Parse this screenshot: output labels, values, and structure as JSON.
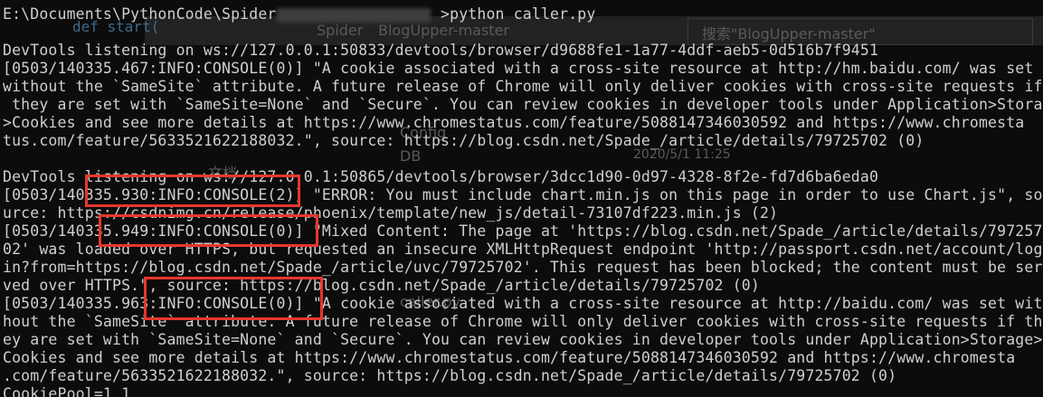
{
  "background_window": {
    "path_segments": [
      "Spider",
      "BlogUpper-master"
    ],
    "search_placeholder": "搜索\"BlogUpper-master\"",
    "sidebar_label": "文档",
    "entry_date": "2020/5/1 11:25",
    "file_entries": [
      "DB",
      "Config",
      "caller.py"
    ],
    "editor_text": "def start("
  },
  "console": {
    "lines": [
      "E:\\Documents\\PythonCode\\Spider                  >python caller.py",
      "",
      "DevTools listening on ws://127.0.0.1:50833/devtools/browser/d9688fe1-1a77-4ddf-aeb5-0d516b7f9451",
      "[0503/140335.467:INFO:CONSOLE(0)] \"A cookie associated with a cross-site resource at http://hm.baidu.com/ was set",
      "without the `SameSite` attribute. A future release of Chrome will only deliver cookies with cross-site requests if",
      " they are set with `SameSite=None` and `Secure`. You can review cookies in developer tools under Application>Storage",
      ">Cookies and see more details at https://www.chromestatus.com/feature/5088147346030592 and https://www.chromesta",
      "tus.com/feature/5633521622188032.\", source: https://blog.csdn.net/Spade_/article/details/79725702 (0)",
      "",
      "DevTools listening on ws://127.0.0.1:50865/devtools/browser/3dcc1d90-0d97-4328-8f2e-fd7d6ba6eda0",
      "[0503/140335.930:INFO:CONSOLE(2)] \"ERROR: You must include chart.min.js on this page in order to use Chart.js\", so",
      "urce: https://csdnimg.cn/release/phoenix/template/new_js/detail-73107df223.min.js (2)",
      "[0503/140335.949:INFO:CONSOLE(0)] \"Mixed Content: The page at 'https://blog.csdn.net/Spade_/article/details/797257",
      "02' was loaded over HTTPS, but requested an insecure XMLHttpRequest endpoint 'http://passport.csdn.net/account/log",
      "in?from=https://blog.csdn.net/Spade_/article/uvc/79725702'. This request has been blocked; the content must be ser",
      "ved over HTTPS.\", source: https://blog.csdn.net/Spade_/article/details/79725702 (0)",
      "[0503/140335.963:INFO:CONSOLE(0)] \"A cookie associated with a cross-site resource at http://baidu.com/ was set wit",
      "hout the `SameSite` attribute. A future release of Chrome will only deliver cookies with cross-site requests if th",
      "ey are set with `SameSite=None` and `Secure`. You can review cookies in developer tools under Application>Storage>",
      "Cookies and see more details at https://www.chromestatus.com/feature/5088147346030592 and https://www.chromesta",
      ".com/feature/5633521622188032.\", source: https://blog.csdn.net/Spade_/article/details/79725702 (0)",
      "CookiePool=1 1"
    ]
  },
  "colors": {
    "console_bg": "#0c0c0c",
    "console_text": "#cfcfcf",
    "highlight_border": "#e8372c"
  }
}
